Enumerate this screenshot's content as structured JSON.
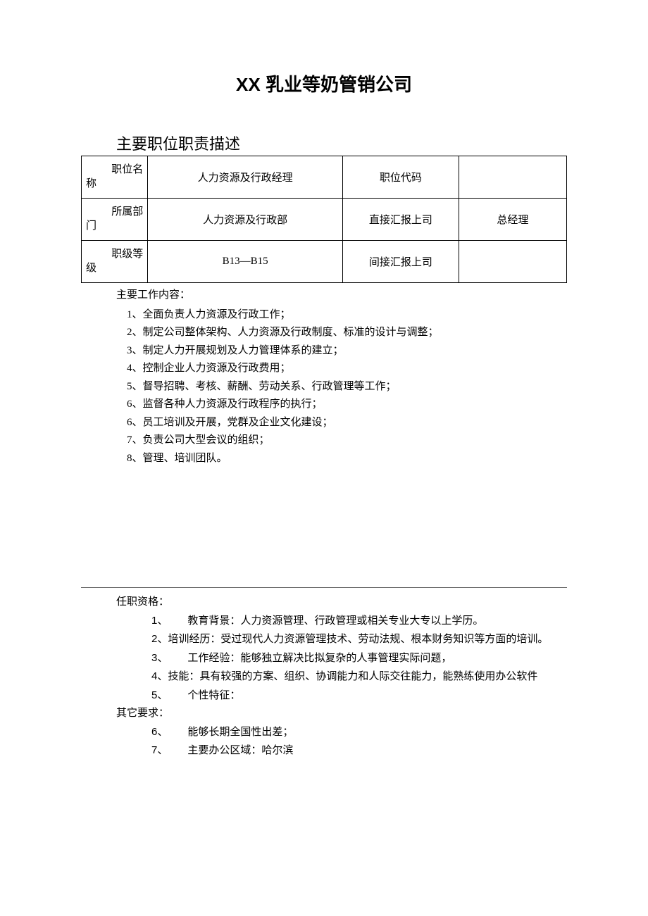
{
  "title": "XX 乳业等奶管销公司",
  "subtitle": "主要职位职责描述",
  "table": {
    "row1": {
      "label_top": "职位名",
      "label_bottom": "称",
      "value": "人力资源及行政经理",
      "code_label": "职位代码",
      "code_value": ""
    },
    "row2": {
      "label_top": "所属部",
      "label_bottom": "门",
      "value": "人力资源及行政部",
      "code_label": "直接汇报上司",
      "code_value": "总经理"
    },
    "row3": {
      "label_top": "职级等",
      "label_bottom": "级",
      "value": "B13—B15",
      "code_label": "间接汇报上司",
      "code_value": ""
    }
  },
  "work": {
    "header": "主要工作内容：",
    "items": [
      "1、全面负责人力资源及行政工作；",
      "2、制定公司整体架构、人力资源及行政制度、标准的设计与调整；",
      "3、制定人力开展规划及人力管理体系的建立；",
      "4、控制企业人力资源及行政费用；",
      "5、督导招聘、考核、薪酬、劳动关系、行政管理等工作；",
      "6、监督各种人力资源及行政程序的执行；",
      "6、员工培训及开展，党群及企业文化建设；",
      "7、负责公司大型会议的组织；",
      "8、管理、培训团队。"
    ]
  },
  "qualifications": {
    "header": "任职资格：",
    "items": [
      {
        "num": "1、",
        "text": "教育背景：人力资源管理、行政管理或相关专业大专以上学历。",
        "indent": true
      },
      {
        "num": "2、",
        "text": "培训经历：受过现代人力资源管理技术、劳动法规、根本财务知识等方面的培训。",
        "indent": false
      },
      {
        "num": "3、",
        "text": "工作经验：能够独立解决比拟复杂的人事管理实际问题，",
        "indent": true
      },
      {
        "num": "4、",
        "text": "技能：具有较强的方案、组织、协调能力和人际交往能力，能熟练使用办公软件",
        "indent": false
      },
      {
        "num": "5、",
        "text": "个性特征：",
        "indent": true
      }
    ]
  },
  "other": {
    "header": "其它要求：",
    "items": [
      {
        "num": "6、",
        "text": "能够长期全国性出差；"
      },
      {
        "num": "7、",
        "text": "主要办公区域：哈尔滨"
      }
    ]
  }
}
